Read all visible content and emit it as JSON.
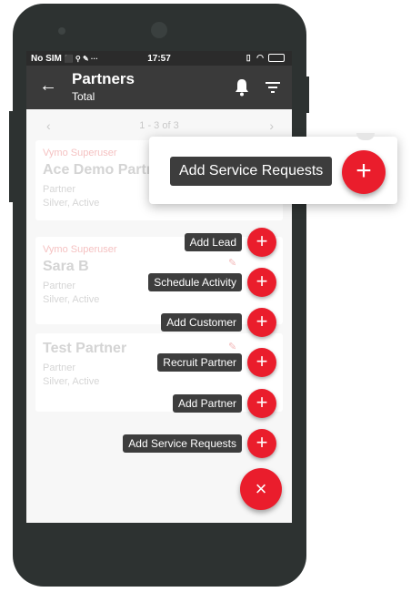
{
  "status_bar": {
    "carrier": "No SIM",
    "time": "17:57",
    "left_icons": "⬛ ⚲ ✎ ···",
    "right_icons": "▯ ◠"
  },
  "app_bar": {
    "back_icon": "←",
    "title": "Partners",
    "subtitle": "Total",
    "bell_icon": "bell-icon",
    "filter_icon": "filter-icon"
  },
  "pager": {
    "text": "1 - 3 of 3",
    "prev": "‹",
    "next": "›"
  },
  "partners": [
    {
      "owner": "Vymo Superuser",
      "name": "Ace Demo Partner",
      "type": "Partner",
      "status": "Silver, Active"
    },
    {
      "owner": "Vymo Superuser",
      "name": "Sara B",
      "type": "Partner",
      "status": "Silver, Active"
    },
    {
      "owner": "",
      "name": "Test Partner",
      "type": "Partner",
      "status": "Silver, Active"
    }
  ],
  "fab_actions": [
    {
      "label": "Add Lead",
      "icon": "+"
    },
    {
      "label": "Schedule Activity",
      "icon": "+"
    },
    {
      "label": "Add Customer",
      "icon": "+"
    },
    {
      "label": "Recruit Partner",
      "icon": "+"
    },
    {
      "label": "Add Partner",
      "icon": "+"
    },
    {
      "label": "Add Service Requests",
      "icon": "+"
    }
  ],
  "fab_close_icon": "×",
  "callout": {
    "label": "Add Service Requests",
    "icon": "+"
  },
  "colors": {
    "accent": "#ea1d2c",
    "app_bar": "#3a3a3a",
    "phone_body": "#2d3231",
    "label_bg": "#3d3d3d"
  }
}
